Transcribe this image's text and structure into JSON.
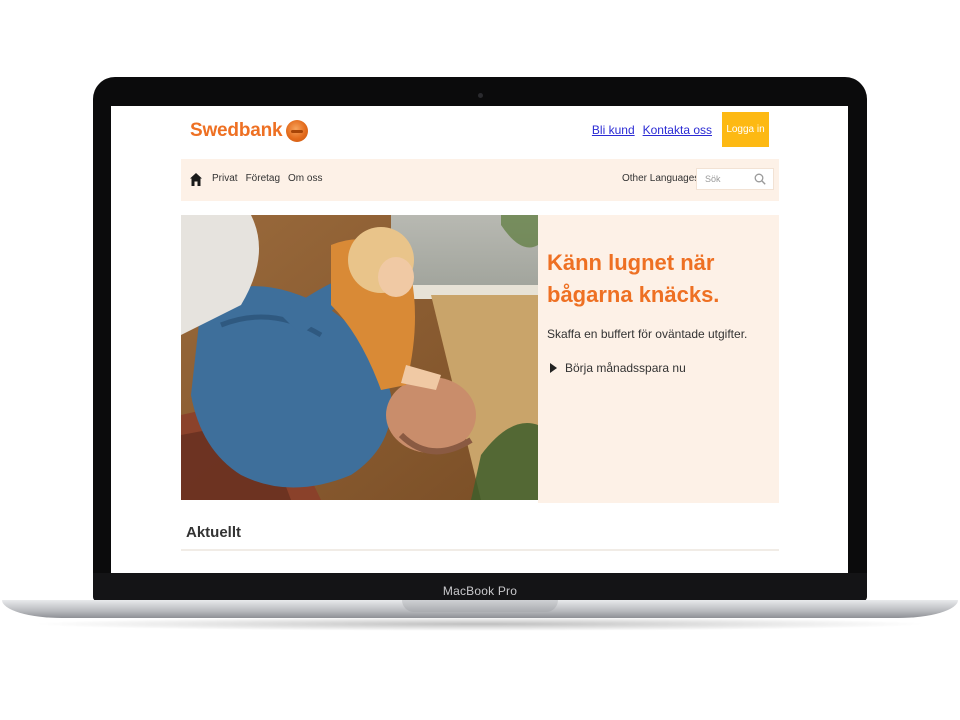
{
  "device": {
    "model_label": "MacBook Pro"
  },
  "site": {
    "logo_text": "Swedbank",
    "top_links": [
      "Bli kund",
      "Kontakta oss"
    ],
    "login_label": "Logga in",
    "nav": {
      "items": [
        "Privat",
        "Företag",
        "Om oss"
      ],
      "language_label": "Other Languages",
      "search_placeholder": "Sök"
    },
    "hero": {
      "heading": "Känn lugnet när bågarna knäcks.",
      "subtext": "Skaffa en buffert för oväntade utgifter.",
      "cta": "Börja månadsspara nu"
    },
    "section_title": "Aktuellt"
  },
  "colors": {
    "brand_orange": "#ee7023",
    "login_button": "#fdb913",
    "nav_background": "#fdf1e7",
    "link_blue": "#2b2bd4"
  },
  "icons": [
    "home-icon",
    "search-icon",
    "caret-down-icon",
    "arrow-right-icon",
    "swedbank-oak-logo"
  ]
}
